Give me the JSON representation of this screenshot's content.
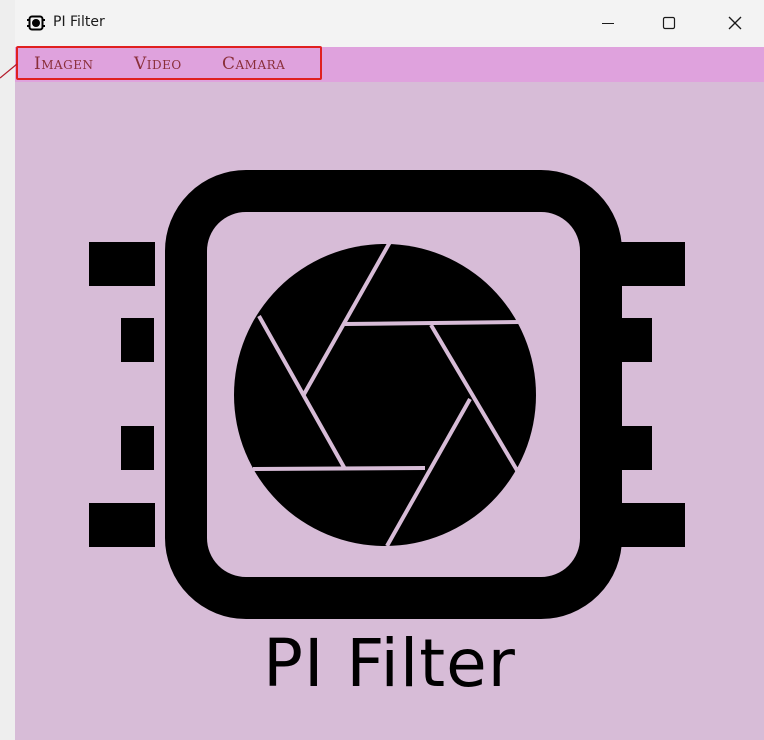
{
  "window": {
    "title": "PI Filter",
    "controls": {
      "minimize": "minimize-icon",
      "maximize": "maximize-icon",
      "close": "close-icon"
    }
  },
  "menu": {
    "items": [
      {
        "label": "Imagen"
      },
      {
        "label": "Video"
      },
      {
        "label": "Camara"
      }
    ]
  },
  "content": {
    "logo_icon": "camera-aperture-film-icon",
    "app_name": "PI Filter"
  },
  "colors": {
    "menubar": "#dfa2dd",
    "content_background": "#d7bcd7",
    "menu_text": "#8a2f3a",
    "highlight_border": "#e02020",
    "titlebar": "#f3f3f3"
  }
}
